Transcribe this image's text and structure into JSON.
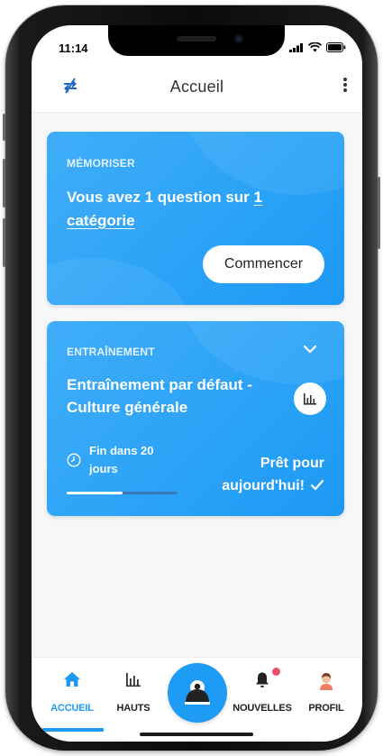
{
  "status_bar": {
    "time": "11:14"
  },
  "app_bar": {
    "title": "Accueil",
    "left_icon": "shuffle-arrows-icon",
    "right_icon": "more-vertical-icon"
  },
  "memorize_card": {
    "label": "MÉMORISER",
    "question_prefix": "Vous avez 1 question sur ",
    "question_link": "1 catégorie",
    "start_button": "Commencer"
  },
  "training_card": {
    "label": "ENTRAÎNEMENT",
    "title": "Entraînement par défaut - Culture générale",
    "end_text": "Fin dans 20 jours",
    "progress": 0.5,
    "ready_line1": "Prêt pour",
    "ready_line2": "aujourd'hui!"
  },
  "tabs": {
    "home": "ACCUEIL",
    "tops": "HAUTS",
    "news": "NOUVELLES",
    "profile": "PROFIL"
  },
  "colors": {
    "accent": "#1e9af5",
    "card": "#2aa2f7",
    "badge": "#ee4d6a"
  }
}
